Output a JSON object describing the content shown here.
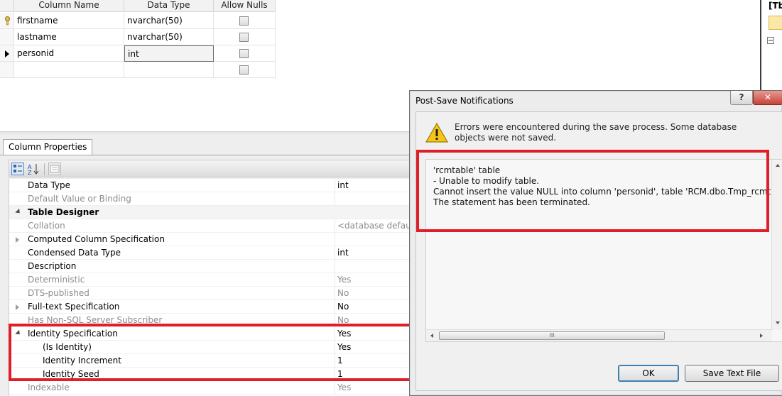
{
  "grid": {
    "headers": [
      "Column Name",
      "Data Type",
      "Allow Nulls"
    ],
    "rows": [
      {
        "name": "firstname",
        "type": "nvarchar(50)"
      },
      {
        "name": "lastname",
        "type": "nvarchar(50)"
      },
      {
        "name": "personid",
        "type": "int"
      },
      {
        "name": "",
        "type": ""
      }
    ]
  },
  "right_strip": {
    "title": "[Tb"
  },
  "column_properties": {
    "tab_label": "Column Properties",
    "rows": [
      {
        "name": "Data Type",
        "value": "int"
      },
      {
        "name": "Default Value or Binding",
        "value": ""
      },
      {
        "name": "Table Designer",
        "value": ""
      },
      {
        "name": "Collation",
        "value": "<database default>"
      },
      {
        "name": "Computed Column Specification",
        "value": ""
      },
      {
        "name": "Condensed Data Type",
        "value": "int"
      },
      {
        "name": "Description",
        "value": ""
      },
      {
        "name": "Deterministic",
        "value": "Yes"
      },
      {
        "name": "DTS-published",
        "value": "No"
      },
      {
        "name": "Full-text Specification",
        "value": "No"
      },
      {
        "name": "Has Non-SQL Server Subscriber",
        "value": "No"
      },
      {
        "name": "Identity Specification",
        "value": "Yes"
      },
      {
        "name": "(Is Identity)",
        "value": "Yes"
      },
      {
        "name": "Identity Increment",
        "value": "1"
      },
      {
        "name": "Identity Seed",
        "value": "1"
      },
      {
        "name": "Indexable",
        "value": "Yes"
      }
    ]
  },
  "dialog": {
    "title": "Post-Save Notifications",
    "help_label": "?",
    "close_label": "✕",
    "message": "Errors were encountered during the save process. Some database objects were not saved.",
    "details": [
      "'rcmtable' table",
      "- Unable to modify table.",
      "Cannot insert the value NULL into column 'personid', table 'RCM.dbo.Tmp_rcmtable'; colu",
      "The statement has been terminated."
    ],
    "ok_label": "OK",
    "save_text_label": "Save Text File",
    "scroll_thumb_grip": "III"
  },
  "colors": {
    "highlight": "#e01e2a",
    "warning": "#f5c518"
  }
}
